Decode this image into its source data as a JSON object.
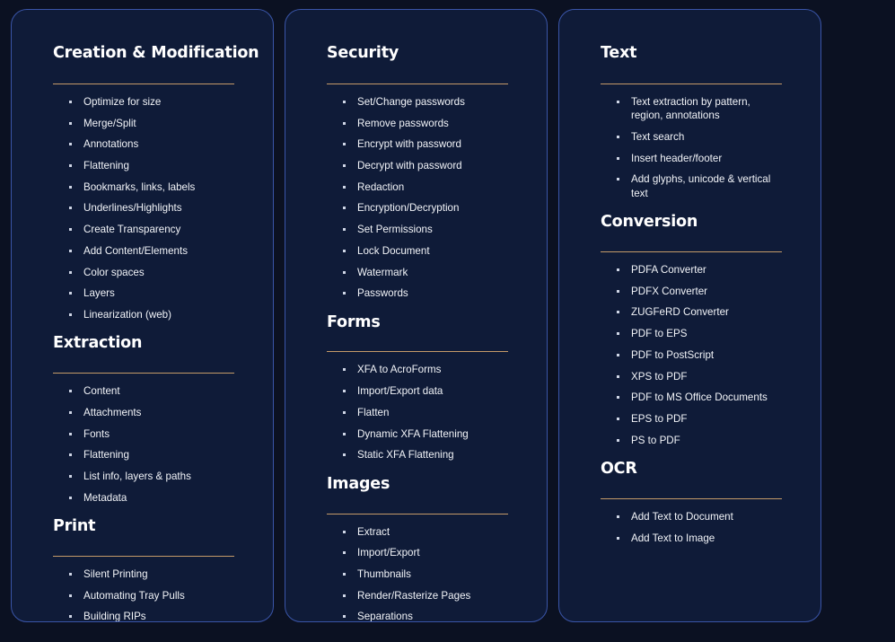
{
  "theme": {
    "page_background": "#0b1122",
    "card_background": "#0f1b38",
    "card_border": "#3a55a8",
    "divider": "#c49a68",
    "heading_text": "#ffffff",
    "list_text": "#f2f4f8",
    "bullet": "#cfd6e6"
  },
  "columns": [
    {
      "name": "column-1",
      "sections": [
        {
          "title": "Creation & Modification",
          "items": [
            "Optimize for size",
            "Merge/Split",
            "Annotations",
            "Flattening",
            "Bookmarks, links, labels",
            "Underlines/Highlights",
            "Create Transparency",
            "Add Content/Elements",
            "Color spaces",
            "Layers",
            "Linearization (web)"
          ]
        },
        {
          "title": "Extraction",
          "items": [
            "Content",
            "Attachments",
            "Fonts",
            "Flattening",
            "List info, layers & paths",
            "Metadata"
          ]
        },
        {
          "title": "Print",
          "items": [
            "Silent Printing",
            "Automating Tray Pulls",
            "Building RIPs"
          ]
        }
      ]
    },
    {
      "name": "column-2",
      "sections": [
        {
          "title": "Security",
          "items": [
            "Set/Change passwords",
            "Remove passwords",
            "Encrypt with password",
            "Decrypt with password",
            "Redaction",
            "Encryption/Decryption",
            "Set Permissions",
            "Lock Document",
            "Watermark",
            "Passwords"
          ]
        },
        {
          "title": "Forms",
          "items": [
            "XFA to AcroForms",
            "Import/Export data",
            "Flatten",
            "Dynamic XFA Flattening",
            "Static XFA Flattening"
          ]
        },
        {
          "title": "Images",
          "items": [
            "Extract",
            "Import/Export",
            "Thumbnails",
            "Render/Rasterize Pages",
            "Separations"
          ]
        }
      ]
    },
    {
      "name": "column-3",
      "sections": [
        {
          "title": "Text",
          "items": [
            "Text extraction by pattern, region, annotations",
            "Text search",
            "Insert header/footer",
            "Add glyphs, unicode & vertical text"
          ]
        },
        {
          "title": "Conversion",
          "items": [
            "PDFA Converter",
            "PDFX Converter",
            "ZUGFeRD Converter",
            "PDF to EPS",
            "PDF to PostScript",
            "XPS to PDF",
            "PDF to MS Office Documents",
            "EPS to PDF",
            "PS to PDF"
          ]
        },
        {
          "title": "OCR",
          "items": [
            "Add Text to Document",
            "Add Text to Image"
          ]
        }
      ]
    }
  ]
}
